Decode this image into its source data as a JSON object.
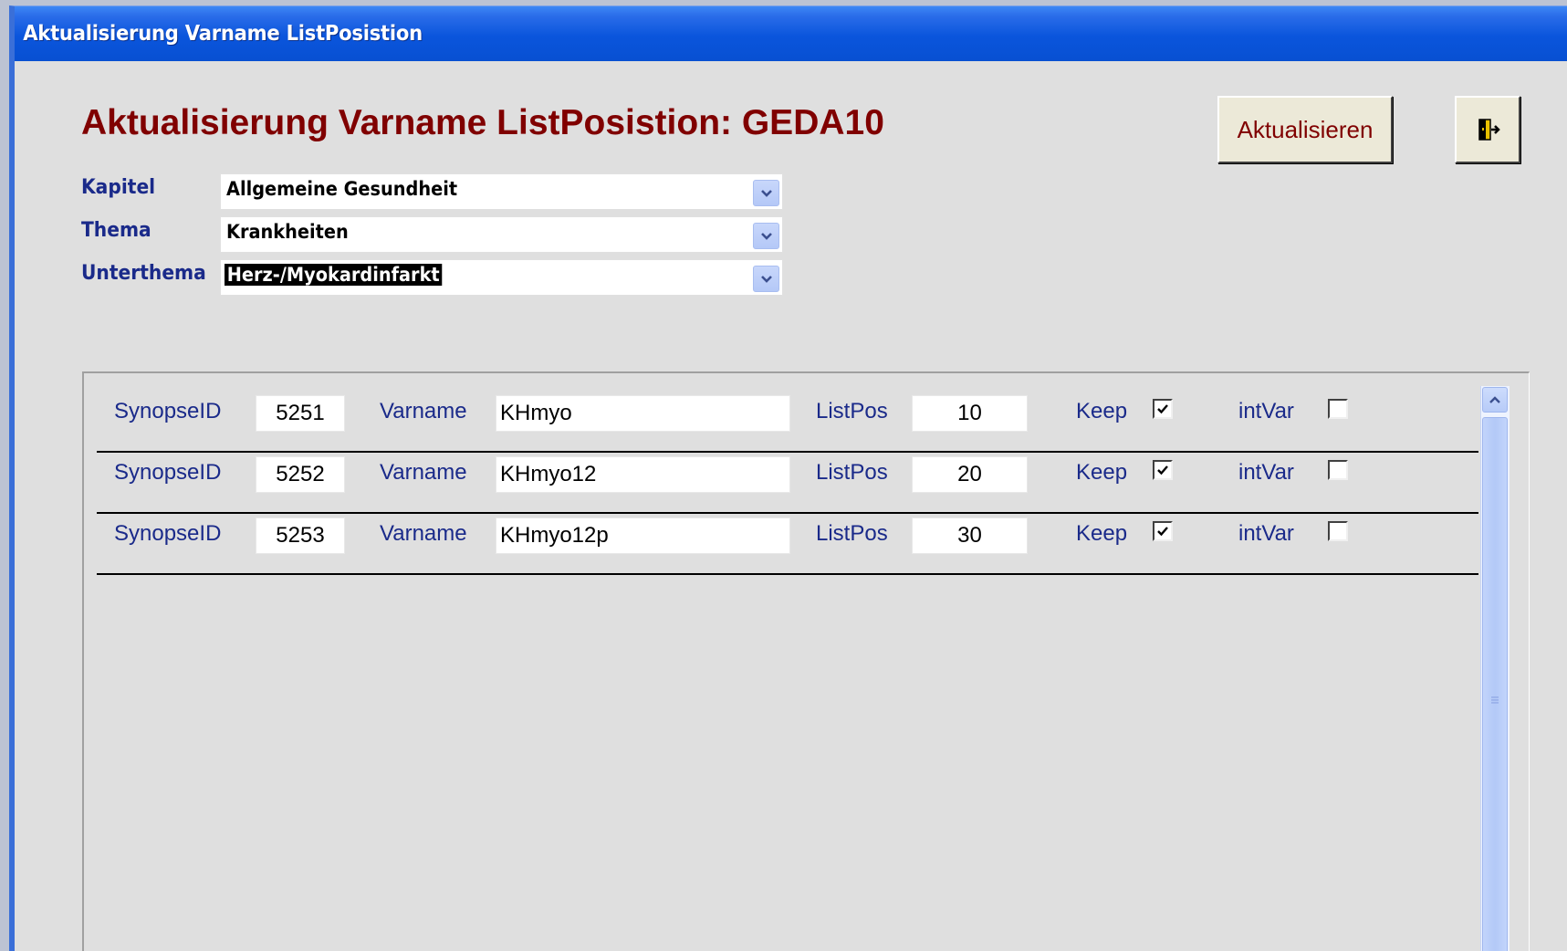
{
  "window": {
    "title": "Aktualisierung Varname ListPosistion"
  },
  "header": {
    "heading": "Aktualisierung Varname ListPosistion: GEDA10"
  },
  "toolbar": {
    "update_label": "Aktualisieren",
    "exit_icon": "exit-door-icon"
  },
  "filters": {
    "kapitel": {
      "label": "Kapitel",
      "value": "Allgemeine Gesundheit"
    },
    "thema": {
      "label": "Thema",
      "value": "Krankheiten"
    },
    "unterthema": {
      "label": "Unterthema",
      "value": "Herz-/Myokardinfarkt"
    }
  },
  "rows": [
    {
      "synopse_label": "SynopseID",
      "synopse_id": "5251",
      "varname_label": "Varname",
      "varname": "KHmyo",
      "listpos_label": "ListPos",
      "listpos": "10",
      "keep_label": "Keep",
      "keep": true,
      "intvar_label": "intVar",
      "intvar": false
    },
    {
      "synopse_label": "SynopseID",
      "synopse_id": "5252",
      "varname_label": "Varname",
      "varname": "KHmyo12",
      "listpos_label": "ListPos",
      "listpos": "20",
      "keep_label": "Keep",
      "keep": true,
      "intvar_label": "intVar",
      "intvar": false
    },
    {
      "synopse_label": "SynopseID",
      "synopse_id": "5253",
      "varname_label": "Varname",
      "varname": "KHmyo12p",
      "listpos_label": "ListPos",
      "listpos": "30",
      "keep_label": "Keep",
      "keep": true,
      "intvar_label": "intVar",
      "intvar": false
    }
  ],
  "colors": {
    "title_bar": "#0a55dc",
    "heading": "#800000",
    "label": "#1a2a8a",
    "form_bg": "#dfdfdf"
  }
}
